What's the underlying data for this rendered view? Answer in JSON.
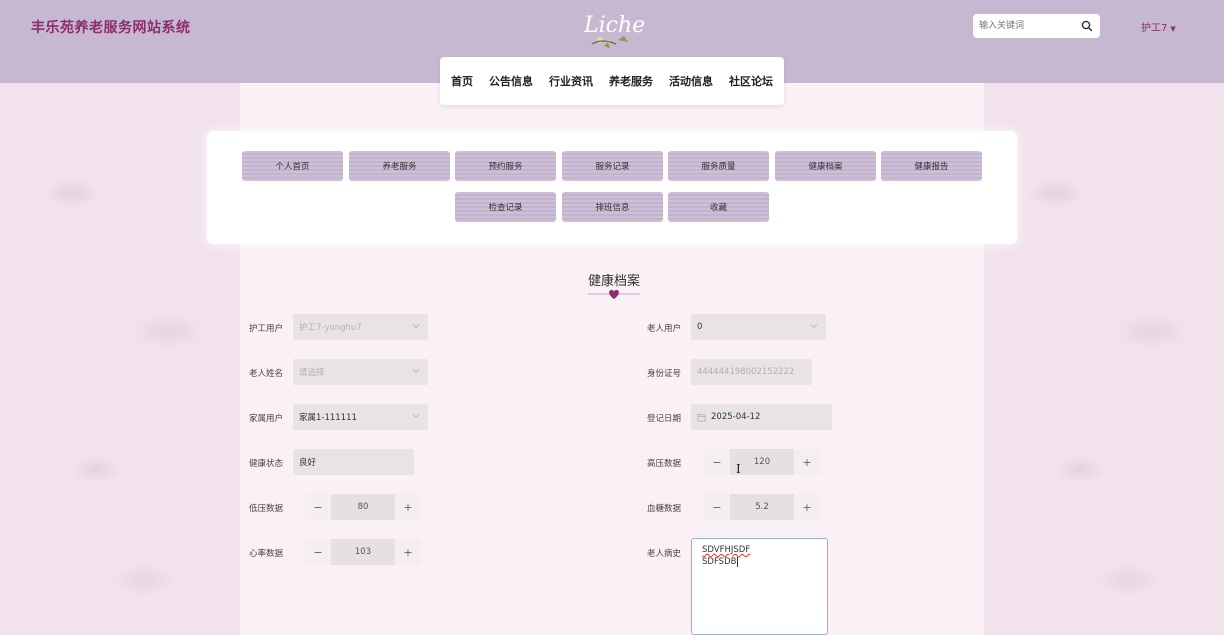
{
  "header": {
    "site_title": "丰乐苑养老服务网站系统",
    "logo_text": "Liche",
    "search_placeholder": "输入关键词",
    "user": "护工7"
  },
  "nav": [
    "首页",
    "公告信息",
    "行业资讯",
    "养老服务",
    "活动信息",
    "社区论坛"
  ],
  "menu": {
    "row1": [
      "个人首页",
      "养老服务",
      "预约服务",
      "服务记录",
      "服务质量",
      "健康档案",
      "健康报告"
    ],
    "row2": [
      "检查记录",
      "排班信息",
      "收藏"
    ]
  },
  "form": {
    "title": "健康档案",
    "nurse_user": {
      "label": "护工用户",
      "value": "护工7-yonghu7"
    },
    "elder_user": {
      "label": "老人用户",
      "value": "0"
    },
    "elder_name": {
      "label": "老人姓名",
      "placeholder": "请选择"
    },
    "id_number": {
      "label": "身份证号",
      "value": "444444198002152222"
    },
    "family_user": {
      "label": "家属用户",
      "value": "家属1-111111"
    },
    "reg_date": {
      "label": "登记日期",
      "value": "2025-04-12"
    },
    "health_status": {
      "label": "健康状态",
      "value": "良好"
    },
    "high_bp": {
      "label": "高压数据",
      "value": "120"
    },
    "low_bp": {
      "label": "低压数据",
      "value": "80"
    },
    "blood_sugar": {
      "label": "血糖数据",
      "value": "5.2"
    },
    "heart_rate": {
      "label": "心率数据",
      "value": "103"
    },
    "history": {
      "label": "老人病史",
      "line1": "SDVFHJSDF",
      "line2": "SDFSDB"
    },
    "minus": "−",
    "plus": "+"
  }
}
